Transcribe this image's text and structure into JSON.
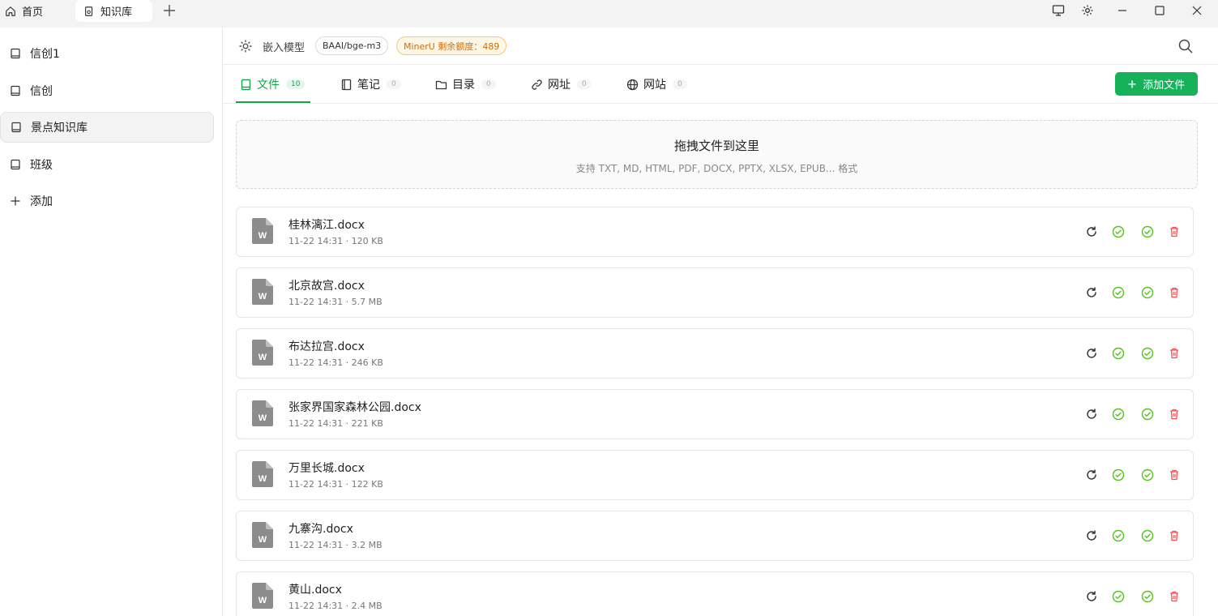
{
  "titlebar": {
    "tabs": [
      {
        "label": "首页",
        "icon": "home-icon"
      },
      {
        "label": "知识库",
        "icon": "knowledge-icon"
      }
    ],
    "window_icons": [
      "monitor-icon",
      "gear-icon",
      "minimize-icon",
      "maximize-icon",
      "close-icon"
    ]
  },
  "sidebar": {
    "items": [
      {
        "label": "信创1",
        "icon": "book-icon"
      },
      {
        "label": "信创",
        "icon": "book-icon"
      },
      {
        "label": "景点知识库",
        "icon": "book-icon",
        "active": true
      },
      {
        "label": "班级",
        "icon": "book-icon"
      }
    ],
    "add_label": "添加"
  },
  "header": {
    "label": "嵌入模型",
    "model": "BAAI/bge-m3",
    "miner_label": "MinerU 剩余额度：489"
  },
  "tabs": [
    {
      "label": "文件",
      "count": "10",
      "icon": "file-icon",
      "active": true
    },
    {
      "label": "笔记",
      "count": "0",
      "icon": "notebook-icon"
    },
    {
      "label": "目录",
      "count": "0",
      "icon": "folder-icon"
    },
    {
      "label": "网址",
      "count": "0",
      "icon": "link-icon"
    },
    {
      "label": "网站",
      "count": "0",
      "icon": "globe-icon"
    }
  ],
  "add_file_label": "添加文件",
  "dropzone": {
    "title": "拖拽文件到这里",
    "subtitle": "支持 TXT, MD, HTML, PDF, DOCX, PPTX, XLSX, EPUB... 格式"
  },
  "files": [
    {
      "name": "桂林漓江.docx",
      "meta": "11-22 14:31 · 120 KB"
    },
    {
      "name": "北京故宫.docx",
      "meta": "11-22 14:31 · 5.7 MB"
    },
    {
      "name": "布达拉宫.docx",
      "meta": "11-22 14:31 · 246 KB"
    },
    {
      "name": "张家界国家森林公园.docx",
      "meta": "11-22 14:31 · 221 KB"
    },
    {
      "name": "万里长城.docx",
      "meta": "11-22 14:31 · 122 KB"
    },
    {
      "name": "九寨沟.docx",
      "meta": "11-22 14:31 · 3.2 MB"
    },
    {
      "name": "黄山.docx",
      "meta": "11-22 14:31 · 2.4 MB"
    }
  ],
  "colors": {
    "accent": "#16b25a",
    "success": "#52c41a",
    "danger": "#ff4d4f",
    "warning": "#d46b08"
  }
}
